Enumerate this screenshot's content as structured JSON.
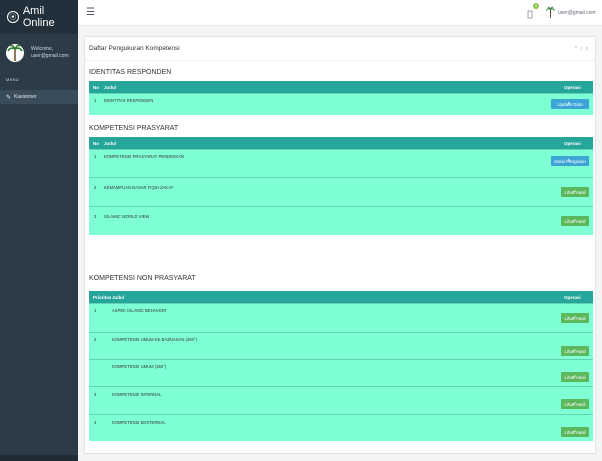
{
  "app": {
    "brand": "Amil Online"
  },
  "sidebar": {
    "greeting_line1": "Welcome,",
    "greeting_line2": "user@gmail.com",
    "menu_tag": "MENU",
    "nav": [
      {
        "label": "Kuesioner",
        "icon": "edit-icon"
      }
    ]
  },
  "topbar": {
    "user_email": "user@gmail.com",
    "notif_count": "0"
  },
  "page": {
    "title": "Daftar Pengukuran Kompetensi",
    "tools": "^ / x"
  },
  "sections": {
    "identitas": {
      "title": "IDENTITAS RESPONDEN",
      "headers": {
        "no": "No",
        "judul": "Judul",
        "operasi": "Operasi"
      },
      "rows": [
        {
          "no": "1",
          "judul": "IDENTITAS RESPONDEN",
          "button": "Update Data"
        }
      ]
    },
    "prasyarat": {
      "title": "KOMPETENSI PRASYARAT",
      "headers": {
        "no": "No",
        "judul": "Judul",
        "operasi": "Operasi"
      },
      "rows": [
        {
          "no": "1",
          "judul": "KOMPETENSI PRASYARAT PENDIDIKAN",
          "button": "Mulai Pengisian"
        },
        {
          "no": "2",
          "judul": "KEMAMPUAN DASAR FIQIH ZAKAT",
          "button": "Lihat Hasil"
        },
        {
          "no": "3",
          "judul": "ISLAMIC WORLD VIEW",
          "button": "Lihat Hasil"
        }
      ]
    },
    "non_prasyarat": {
      "title": "KOMPETENSI NON PRASYARAT",
      "headers": {
        "no": "Prioritas",
        "judul": "Judul",
        "operasi": "Operasi"
      },
      "rows": [
        {
          "no": "1",
          "judul": "ASPEK ISLAMIC BEHAVIOR",
          "button": "Lihat Hasil"
        },
        {
          "no": "2",
          "judul": "KOMPETENSI UMUM KE-BAZNASAN (360°)",
          "button": "Lihat Hasil"
        },
        {
          "no": "",
          "judul": "KOMPETENSI UMUM (360°)",
          "button": "Lihat Hasil"
        },
        {
          "no": "3",
          "judul": "KOMPETENSI INTERNAL",
          "button": "Lihat Hasil"
        },
        {
          "no": "4",
          "judul": "KOMPETENSI EKSTERNAL",
          "button": "Lihat Hasil"
        }
      ]
    }
  },
  "colors": {
    "header": "#26a69a",
    "row_bg": "#7fffd4",
    "btn_blue": "#3ca5d5",
    "btn_green": "#5cb85c",
    "sidebar": "#2c3b48"
  }
}
